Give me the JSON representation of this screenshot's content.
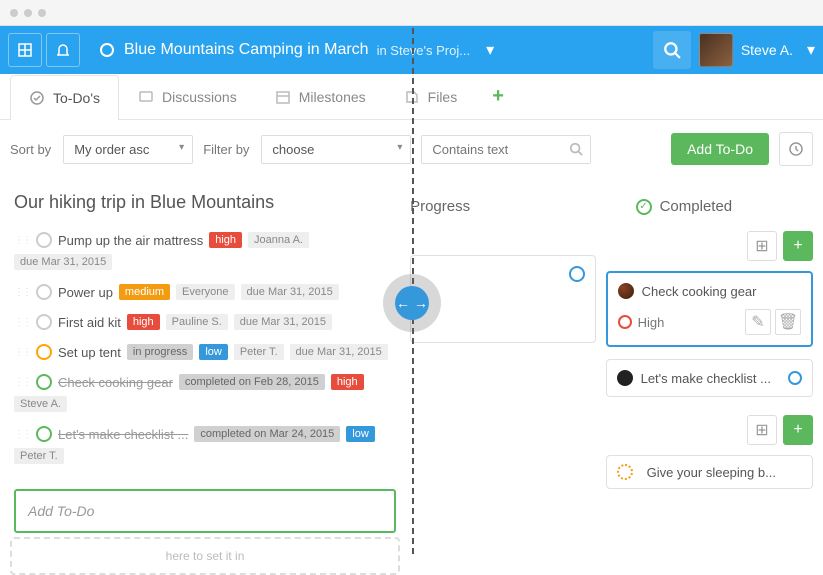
{
  "header": {
    "project_title": "Blue Mountains Camping in March",
    "project_sub": "in Steve's Proj...",
    "user_name": "Steve A."
  },
  "tabs": {
    "todos": "To-Do's",
    "discussions": "Discussions",
    "milestones": "Milestones",
    "files": "Files"
  },
  "filters": {
    "sort_label": "Sort by",
    "sort_value": "My order asc",
    "filter_label": "Filter by",
    "filter_value": "choose",
    "contains_placeholder": "Contains text",
    "add_btn": "Add To-Do"
  },
  "list": {
    "title": "Our hiking trip in Blue Mountains",
    "add_placeholder": "Add To-Do",
    "items": [
      {
        "name": "Pump up the air mattress",
        "priority": "high",
        "assignee": "Joanna A.",
        "due": "due Mar 31, 2015",
        "status": "open"
      },
      {
        "name": "Power up",
        "priority": "medium",
        "assignee": "Everyone",
        "due": "due Mar 31, 2015",
        "status": "open"
      },
      {
        "name": "First aid kit",
        "priority": "high",
        "assignee": "Pauline S.",
        "due": "due Mar 31, 2015",
        "status": "open"
      },
      {
        "name": "Set up tent",
        "priority": "low",
        "assignee": "Peter T.",
        "due": "due Mar 31, 2015",
        "status": "in progress"
      },
      {
        "name": "Check cooking gear",
        "priority": "high",
        "assignee": "Steve A.",
        "completed_on": "completed on Feb 28, 2015",
        "status": "completed"
      },
      {
        "name": "Let's make checklist ...",
        "priority": "low",
        "assignee": "Peter T.",
        "completed_on": "completed on Mar 24, 2015",
        "status": "completed"
      }
    ]
  },
  "columns": {
    "progress_label": "Progress",
    "completed_label": "Completed",
    "dashed_hint": "here to set it in"
  },
  "cards": {
    "c1_title": "Check cooking gear",
    "c1_priority": "High",
    "c2_title": "Let's make checklist ...",
    "c3_title": "Give your sleeping b..."
  }
}
